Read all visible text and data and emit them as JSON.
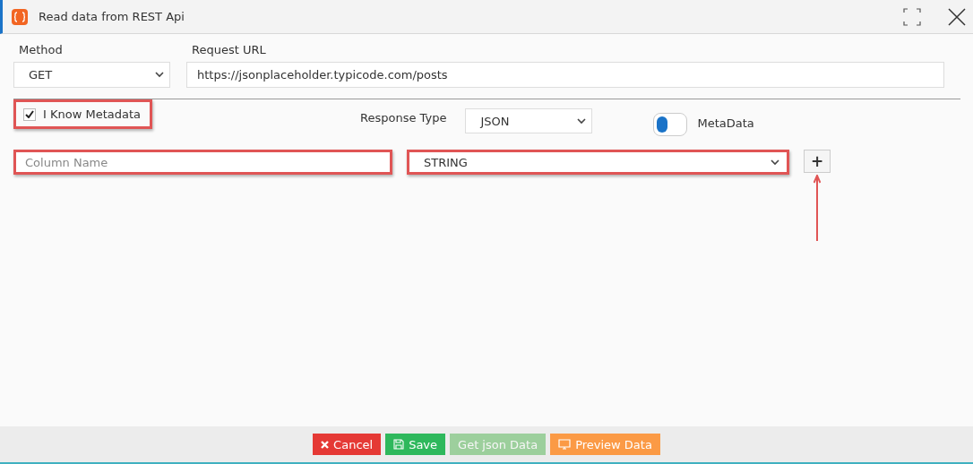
{
  "window": {
    "title": "Read data from REST Api"
  },
  "method": {
    "label": "Method",
    "value": "GET"
  },
  "request_url": {
    "label": "Request URL",
    "value": "https://jsonplaceholder.typicode.com/posts"
  },
  "know_metadata": {
    "label": "I Know Metadata",
    "checked": true
  },
  "response_type": {
    "label": "Response Type",
    "value": "JSON"
  },
  "metadata_toggle": {
    "label": "MetaData",
    "on": false
  },
  "column": {
    "placeholder": "Column Name",
    "type": "STRING",
    "add": "+"
  },
  "buttons": [
    {
      "kind": "cancel",
      "label": "Cancel",
      "disabled": false
    },
    {
      "kind": "save",
      "label": "Save",
      "disabled": false
    },
    {
      "kind": "plain",
      "label": "Get json Data",
      "disabled": true
    },
    {
      "kind": "preview",
      "label": "Preview Data",
      "disabled": false
    }
  ]
}
